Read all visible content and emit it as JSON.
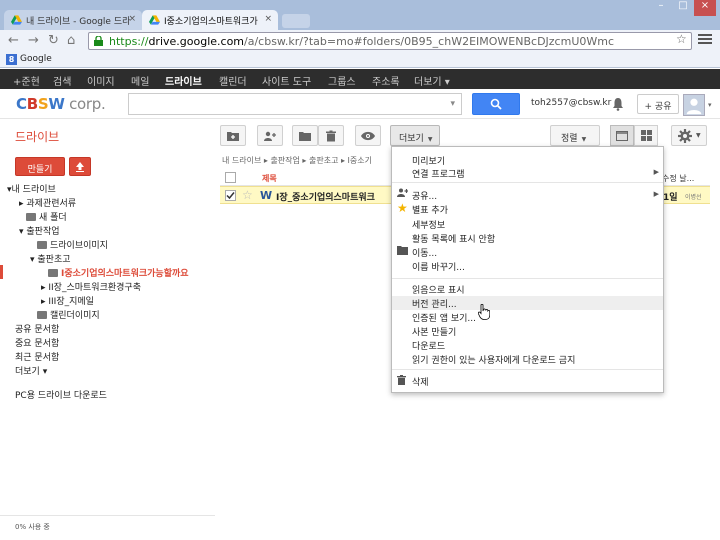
{
  "browser": {
    "tabs": [
      {
        "label": "내 드라이브 - Google 드라",
        "close": "×"
      },
      {
        "label": "I중소기업의스마트워크가",
        "close": "×"
      }
    ],
    "url_scheme": "https://",
    "url_host": "drive.google.com",
    "url_rest": "/a/cbsw.kr/?tab=mo#folders/0B95_chW2EIMOWENBcDJzcmU0Wmc",
    "bookmark": "Google",
    "bookmark_icon": "8"
  },
  "gbar": {
    "items": [
      "+준현",
      "검색",
      "이미지",
      "메일",
      "드라이브",
      "캘린더",
      "사이트 도구",
      "그룹스",
      "주소록",
      "더보기 ▾"
    ]
  },
  "header": {
    "logo_c": "C",
    "logo_b": "B",
    "logo_s": "S",
    "logo_w": "W",
    "logo_corp": " corp.",
    "user_email": "toh2557@cbsw.kr",
    "share_label": "+ 공유"
  },
  "toolbar": {
    "drive_title": "드라이브",
    "more_label": "더보기",
    "sort_label": "정렬"
  },
  "sidebar": {
    "create_label": "만들기",
    "tree": [
      {
        "label": "▾내 드라이브"
      },
      {
        "label": "▸ 과제관련서류"
      },
      {
        "label": "새 폴더"
      },
      {
        "label": "▾ 출판작업"
      },
      {
        "label": "드라이브이미지"
      },
      {
        "label": "▾ 출판초고"
      },
      {
        "label": "I중소기업의스마트워크가능할까요"
      },
      {
        "label": "▸ II장_스마트워크환경구축"
      },
      {
        "label": "▸ III장_지메일"
      },
      {
        "label": "캘린더이미지"
      }
    ],
    "links": [
      "공유 문서함",
      "중요 문서함",
      "최근 문서함",
      "더보기 ▾"
    ],
    "pc_download": "PC용 드라이브 다운로드",
    "usage": "0% 사용 중"
  },
  "filelist": {
    "breadcrumb": "내 드라이브  ▸  출판작업  ▸  출판초고  ▸  I중소기",
    "col_title": "제목",
    "col_modified": "수정 날...",
    "file_name": "I장_중소기업의스마트워크",
    "file_date": "1일",
    "file_owner": "이병선"
  },
  "menu": {
    "items": [
      "미리보기",
      "연결 프로그램",
      "공유...",
      "별표 추가",
      "세부정보",
      "활동 목록에 표시 안함",
      "이동...",
      "이름 바꾸기...",
      "읽음으로 표시",
      "버전 관리...",
      "인증된 앱 보기...",
      "사본 만들기",
      "다운로드",
      "읽기 권한이 있는 사용자에게 다운로드 금지",
      "삭제"
    ]
  },
  "colors": {
    "accent_red": "#dd4b39",
    "search_blue": "#4285f4",
    "gbar_bg": "#2d2d2d",
    "selected_row": "#fff9c4"
  }
}
